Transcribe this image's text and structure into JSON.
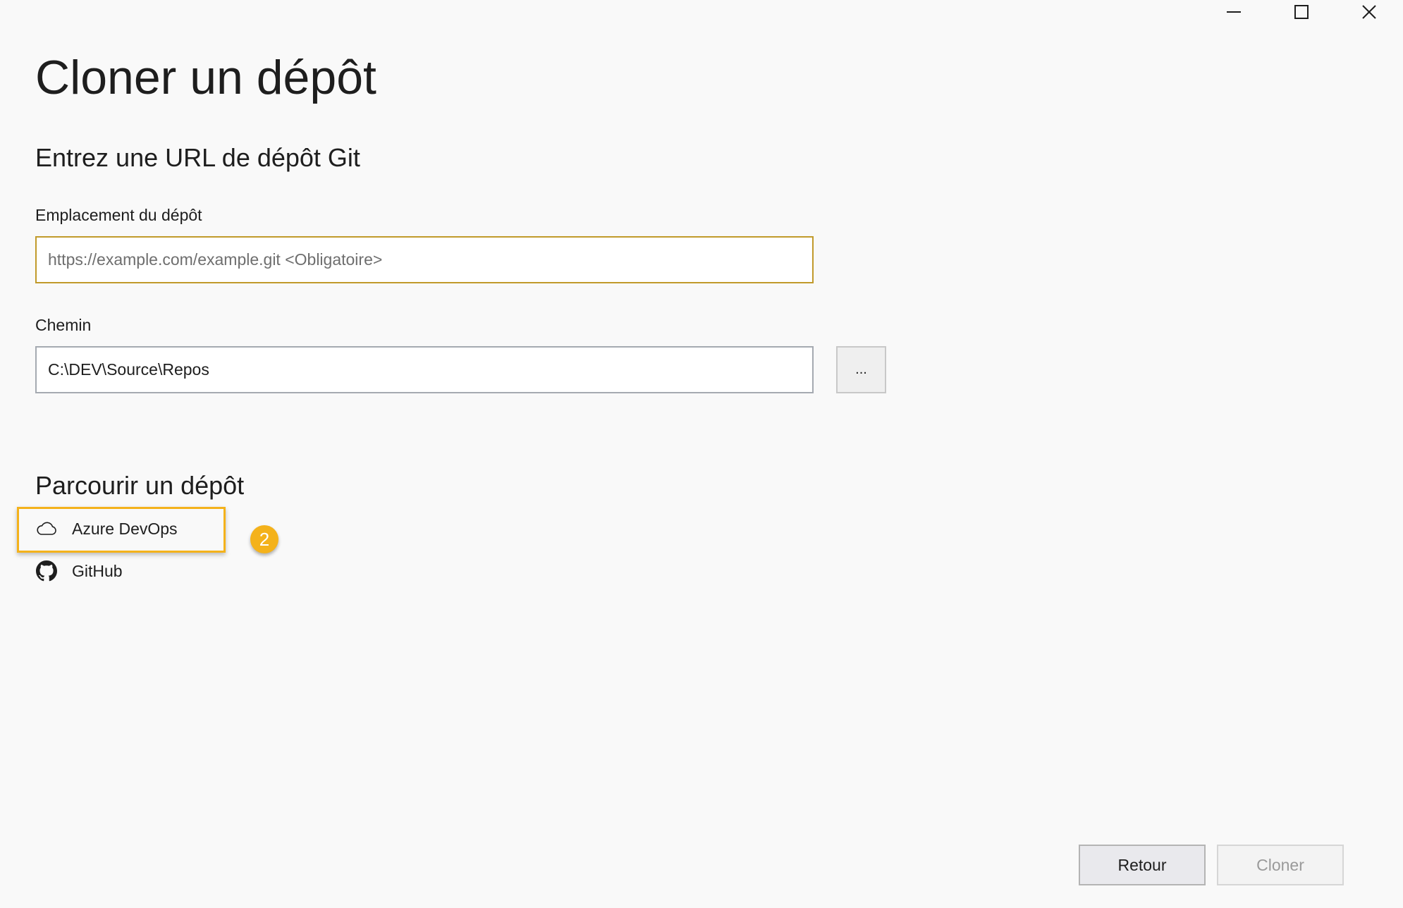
{
  "window_controls": {
    "minimize_icon": "minimize-icon",
    "maximize_icon": "maximize-icon",
    "close_icon": "close-icon"
  },
  "page": {
    "title": "Cloner un dépôt"
  },
  "url_section": {
    "title": "Entrez une URL de dépôt Git",
    "repo_location_label": "Emplacement du dépôt",
    "repo_location_value": "",
    "repo_location_placeholder": "https://example.com/example.git <Obligatoire>",
    "path_label": "Chemin",
    "path_value": "C:\\DEV\\Source\\Repos",
    "browse_label": "..."
  },
  "browse_section": {
    "title": "Parcourir un dépôt",
    "providers": [
      {
        "label": "Azure DevOps",
        "icon": "cloud-icon"
      },
      {
        "label": "GitHub",
        "icon": "github-icon"
      }
    ]
  },
  "annotation": {
    "step_number": "2",
    "highlight_color": "#f4b21b"
  },
  "footer": {
    "back_label": "Retour",
    "clone_label": "Cloner"
  },
  "colors": {
    "background": "#f9f9f9",
    "focus_border": "#c19a2b",
    "field_border": "#a5aab1",
    "disabled_text": "#9a9a9a"
  }
}
